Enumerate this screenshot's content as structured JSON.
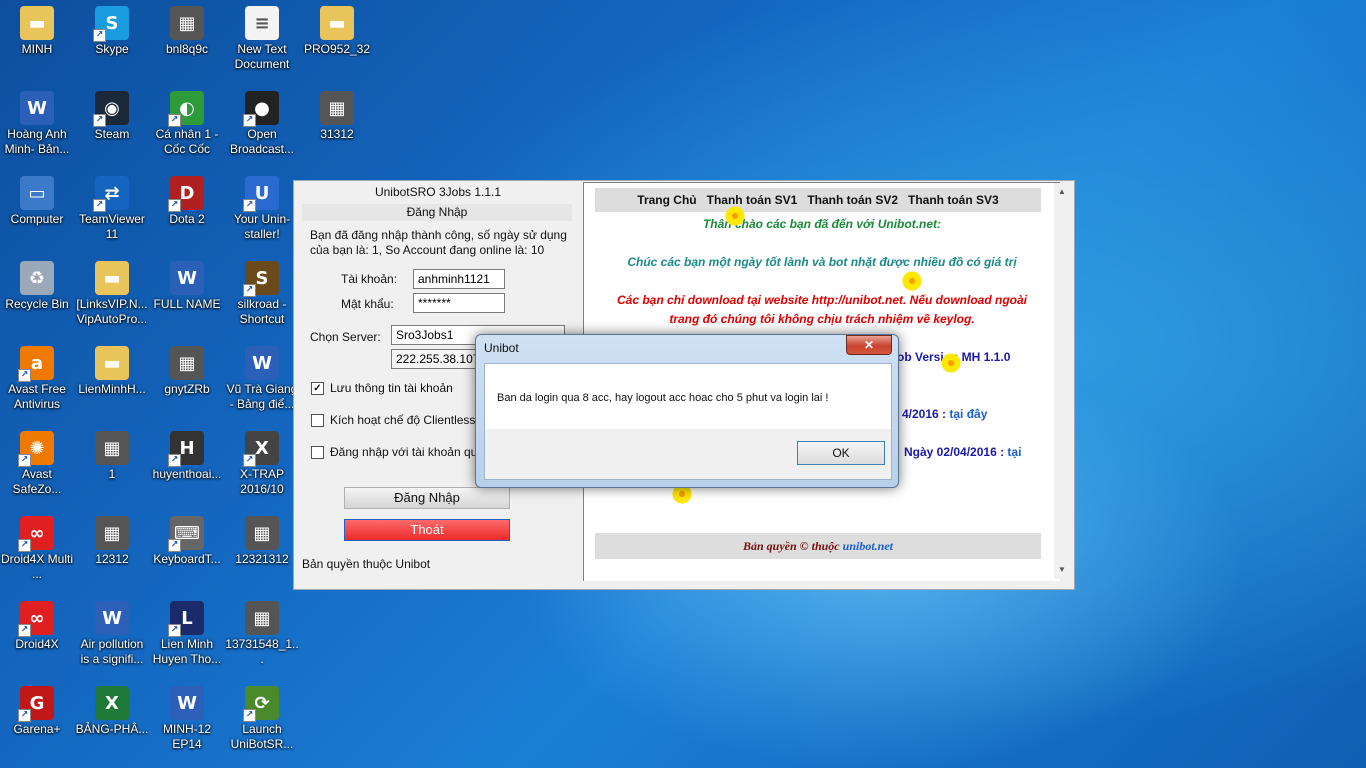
{
  "desktop_icons": [
    {
      "label": "MINH",
      "icon": "folder-icon"
    },
    {
      "label": "Skype",
      "icon": "skype-icon"
    },
    {
      "label": "bnl8q9c",
      "icon": "image-icon"
    },
    {
      "label": "New Text Document",
      "icon": "text-document-icon"
    },
    {
      "label": "PRO952_32",
      "icon": "folder-icon"
    },
    {
      "label": "Hoàng Anh Minh- Bản...",
      "icon": "word-document-icon"
    },
    {
      "label": "Steam",
      "icon": "steam-icon"
    },
    {
      "label": "Cá nhân 1 - Cốc Cốc",
      "icon": "coccoc-icon"
    },
    {
      "label": "Open Broadcast...",
      "icon": "obs-icon"
    },
    {
      "label": "31312",
      "icon": "image-icon"
    },
    {
      "label": "Computer",
      "icon": "computer-icon"
    },
    {
      "label": "TeamViewer 11",
      "icon": "teamviewer-icon"
    },
    {
      "label": "Dota 2",
      "icon": "dota-icon"
    },
    {
      "label": "Your Unin-staller!",
      "icon": "uninstaller-icon"
    },
    {
      "label": "Recycle Bin",
      "icon": "recycle-bin-icon"
    },
    {
      "label": "[LinksVIP.N... VipAutoPro...",
      "icon": "folder-icon"
    },
    {
      "label": "FULL NAME",
      "icon": "word-document-icon"
    },
    {
      "label": "silkroad - Shortcut",
      "icon": "silkroad-icon"
    },
    {
      "label": "Avast Free Antivirus",
      "icon": "avast-icon"
    },
    {
      "label": "LienMinhH...",
      "icon": "folder-icon"
    },
    {
      "label": "gnytZRb",
      "icon": "image-icon"
    },
    {
      "label": "Vũ Trà Giang - Bảng điể...",
      "icon": "word-document-icon"
    },
    {
      "label": "Avast SafeZo...",
      "icon": "avast-safezone-icon"
    },
    {
      "label": "1",
      "icon": "image-icon"
    },
    {
      "label": "huyenthoai...",
      "icon": "game-icon"
    },
    {
      "label": "X-TRAP 2016/10",
      "icon": "xtrap-icon"
    },
    {
      "label": "Droid4X Multi ...",
      "icon": "droid4x-icon"
    },
    {
      "label": "12312",
      "icon": "image-icon"
    },
    {
      "label": "KeyboardT...",
      "icon": "keyboard-icon"
    },
    {
      "label": "12321312",
      "icon": "image-icon"
    },
    {
      "label": "Droid4X",
      "icon": "droid4x-icon"
    },
    {
      "label": "Air pollution is a signifi...",
      "icon": "word-document-icon"
    },
    {
      "label": "Lien Minh Huyen Tho...",
      "icon": "lol-icon"
    },
    {
      "label": "13731548_1...",
      "icon": "image-icon"
    },
    {
      "label": "Garena+",
      "icon": "garena-icon"
    },
    {
      "label": "BẢNG-PHÂ...",
      "icon": "excel-document-icon"
    },
    {
      "label": "MINH-12 EP14",
      "icon": "word-document-icon"
    },
    {
      "label": "Launch UniBotSR...",
      "icon": "unibot-icon"
    }
  ],
  "app": {
    "title": "UnibotSRO 3Jobs 1.1.1",
    "login_header": "Đăng Nhập",
    "status_text": "Bạn đã đăng nhập thành công, số ngày sử dụng của bạn là: 1, So Account đang online là: 10",
    "username_label": "Tài khoản:",
    "username_value": "anhminh1121",
    "password_label": "Mật khẩu:",
    "password_value": "*******",
    "server_label": "Chọn Server:",
    "server_value": "Sro3Jobs1",
    "ip_value": "222.255.38.107",
    "remember_label": "Lưu thông tin tài khoản",
    "remember_mark": "✓",
    "clientless_label": "Kích hoạt chế độ Clientless",
    "other_account_label": "Đăng nhập với tài khoản qu",
    "login_button": "Đăng Nhập",
    "exit_button": "Thoát",
    "copyright": "Bản quyền thuộc Unibot"
  },
  "web": {
    "nav": [
      "Trang Chủ",
      "Thanh toán SV1",
      "Thanh toán SV2",
      "Thanh toán SV3"
    ],
    "welcome": "Thân chào các bạn đã đến với Unibot.net:",
    "wish": "Chúc các bạn một ngày tốt lành và bot nhặt được nhiều đồ có giá trị",
    "warning_line1": "Các bạn chỉ download tại website http://unibot.net. Nếu download ngoài",
    "warning_line2": "trang đó chúng tôi không chịu trách nhiệm về keylog.",
    "version_fragment": "ob Version MH 1.1.0",
    "date_fragment": "4/2016 :",
    "date_link": "tại đây",
    "date2_fragment": "Ngày 02/04/2016 :",
    "date2_link": "tại",
    "footer_text": "Bản quyền © thuộc",
    "footer_link": "unibot.net",
    "colors": {
      "welcome": "#1a8a3a",
      "wish": "#1a8a8a",
      "warning": "#e00000",
      "version": "#1a1aaa",
      "link": "#1a5fd0"
    }
  },
  "dialog": {
    "title": "Unibot",
    "message": "Ban da login qua 8 acc, hay logout acc hoac cho 5 phut va login lai !",
    "ok_button": "OK",
    "close_glyph": "✕"
  }
}
